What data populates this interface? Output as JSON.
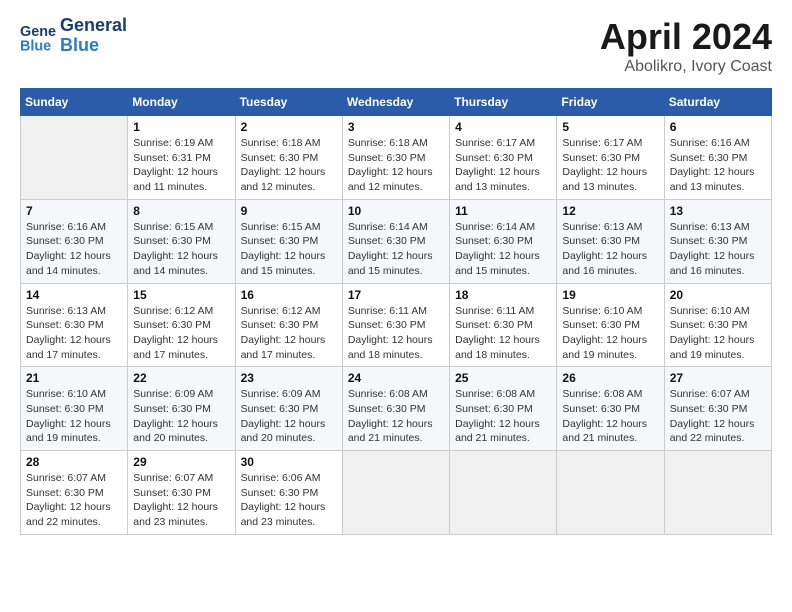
{
  "header": {
    "logo_general": "General",
    "logo_blue": "Blue",
    "month_title": "April 2024",
    "location": "Abolikro, Ivory Coast"
  },
  "weekdays": [
    "Sunday",
    "Monday",
    "Tuesday",
    "Wednesday",
    "Thursday",
    "Friday",
    "Saturday"
  ],
  "weeks": [
    [
      {
        "day": "",
        "sunrise": "",
        "sunset": "",
        "daylight": "",
        "empty": true
      },
      {
        "day": "1",
        "sunrise": "Sunrise: 6:19 AM",
        "sunset": "Sunset: 6:31 PM",
        "daylight": "Daylight: 12 hours and 11 minutes.",
        "empty": false
      },
      {
        "day": "2",
        "sunrise": "Sunrise: 6:18 AM",
        "sunset": "Sunset: 6:30 PM",
        "daylight": "Daylight: 12 hours and 12 minutes.",
        "empty": false
      },
      {
        "day": "3",
        "sunrise": "Sunrise: 6:18 AM",
        "sunset": "Sunset: 6:30 PM",
        "daylight": "Daylight: 12 hours and 12 minutes.",
        "empty": false
      },
      {
        "day": "4",
        "sunrise": "Sunrise: 6:17 AM",
        "sunset": "Sunset: 6:30 PM",
        "daylight": "Daylight: 12 hours and 13 minutes.",
        "empty": false
      },
      {
        "day": "5",
        "sunrise": "Sunrise: 6:17 AM",
        "sunset": "Sunset: 6:30 PM",
        "daylight": "Daylight: 12 hours and 13 minutes.",
        "empty": false
      },
      {
        "day": "6",
        "sunrise": "Sunrise: 6:16 AM",
        "sunset": "Sunset: 6:30 PM",
        "daylight": "Daylight: 12 hours and 13 minutes.",
        "empty": false
      }
    ],
    [
      {
        "day": "7",
        "sunrise": "Sunrise: 6:16 AM",
        "sunset": "Sunset: 6:30 PM",
        "daylight": "Daylight: 12 hours and 14 minutes.",
        "empty": false
      },
      {
        "day": "8",
        "sunrise": "Sunrise: 6:15 AM",
        "sunset": "Sunset: 6:30 PM",
        "daylight": "Daylight: 12 hours and 14 minutes.",
        "empty": false
      },
      {
        "day": "9",
        "sunrise": "Sunrise: 6:15 AM",
        "sunset": "Sunset: 6:30 PM",
        "daylight": "Daylight: 12 hours and 15 minutes.",
        "empty": false
      },
      {
        "day": "10",
        "sunrise": "Sunrise: 6:14 AM",
        "sunset": "Sunset: 6:30 PM",
        "daylight": "Daylight: 12 hours and 15 minutes.",
        "empty": false
      },
      {
        "day": "11",
        "sunrise": "Sunrise: 6:14 AM",
        "sunset": "Sunset: 6:30 PM",
        "daylight": "Daylight: 12 hours and 15 minutes.",
        "empty": false
      },
      {
        "day": "12",
        "sunrise": "Sunrise: 6:13 AM",
        "sunset": "Sunset: 6:30 PM",
        "daylight": "Daylight: 12 hours and 16 minutes.",
        "empty": false
      },
      {
        "day": "13",
        "sunrise": "Sunrise: 6:13 AM",
        "sunset": "Sunset: 6:30 PM",
        "daylight": "Daylight: 12 hours and 16 minutes.",
        "empty": false
      }
    ],
    [
      {
        "day": "14",
        "sunrise": "Sunrise: 6:13 AM",
        "sunset": "Sunset: 6:30 PM",
        "daylight": "Daylight: 12 hours and 17 minutes.",
        "empty": false
      },
      {
        "day": "15",
        "sunrise": "Sunrise: 6:12 AM",
        "sunset": "Sunset: 6:30 PM",
        "daylight": "Daylight: 12 hours and 17 minutes.",
        "empty": false
      },
      {
        "day": "16",
        "sunrise": "Sunrise: 6:12 AM",
        "sunset": "Sunset: 6:30 PM",
        "daylight": "Daylight: 12 hours and 17 minutes.",
        "empty": false
      },
      {
        "day": "17",
        "sunrise": "Sunrise: 6:11 AM",
        "sunset": "Sunset: 6:30 PM",
        "daylight": "Daylight: 12 hours and 18 minutes.",
        "empty": false
      },
      {
        "day": "18",
        "sunrise": "Sunrise: 6:11 AM",
        "sunset": "Sunset: 6:30 PM",
        "daylight": "Daylight: 12 hours and 18 minutes.",
        "empty": false
      },
      {
        "day": "19",
        "sunrise": "Sunrise: 6:10 AM",
        "sunset": "Sunset: 6:30 PM",
        "daylight": "Daylight: 12 hours and 19 minutes.",
        "empty": false
      },
      {
        "day": "20",
        "sunrise": "Sunrise: 6:10 AM",
        "sunset": "Sunset: 6:30 PM",
        "daylight": "Daylight: 12 hours and 19 minutes.",
        "empty": false
      }
    ],
    [
      {
        "day": "21",
        "sunrise": "Sunrise: 6:10 AM",
        "sunset": "Sunset: 6:30 PM",
        "daylight": "Daylight: 12 hours and 19 minutes.",
        "empty": false
      },
      {
        "day": "22",
        "sunrise": "Sunrise: 6:09 AM",
        "sunset": "Sunset: 6:30 PM",
        "daylight": "Daylight: 12 hours and 20 minutes.",
        "empty": false
      },
      {
        "day": "23",
        "sunrise": "Sunrise: 6:09 AM",
        "sunset": "Sunset: 6:30 PM",
        "daylight": "Daylight: 12 hours and 20 minutes.",
        "empty": false
      },
      {
        "day": "24",
        "sunrise": "Sunrise: 6:08 AM",
        "sunset": "Sunset: 6:30 PM",
        "daylight": "Daylight: 12 hours and 21 minutes.",
        "empty": false
      },
      {
        "day": "25",
        "sunrise": "Sunrise: 6:08 AM",
        "sunset": "Sunset: 6:30 PM",
        "daylight": "Daylight: 12 hours and 21 minutes.",
        "empty": false
      },
      {
        "day": "26",
        "sunrise": "Sunrise: 6:08 AM",
        "sunset": "Sunset: 6:30 PM",
        "daylight": "Daylight: 12 hours and 21 minutes.",
        "empty": false
      },
      {
        "day": "27",
        "sunrise": "Sunrise: 6:07 AM",
        "sunset": "Sunset: 6:30 PM",
        "daylight": "Daylight: 12 hours and 22 minutes.",
        "empty": false
      }
    ],
    [
      {
        "day": "28",
        "sunrise": "Sunrise: 6:07 AM",
        "sunset": "Sunset: 6:30 PM",
        "daylight": "Daylight: 12 hours and 22 minutes.",
        "empty": false
      },
      {
        "day": "29",
        "sunrise": "Sunrise: 6:07 AM",
        "sunset": "Sunset: 6:30 PM",
        "daylight": "Daylight: 12 hours and 23 minutes.",
        "empty": false
      },
      {
        "day": "30",
        "sunrise": "Sunrise: 6:06 AM",
        "sunset": "Sunset: 6:30 PM",
        "daylight": "Daylight: 12 hours and 23 minutes.",
        "empty": false
      },
      {
        "day": "",
        "sunrise": "",
        "sunset": "",
        "daylight": "",
        "empty": true
      },
      {
        "day": "",
        "sunrise": "",
        "sunset": "",
        "daylight": "",
        "empty": true
      },
      {
        "day": "",
        "sunrise": "",
        "sunset": "",
        "daylight": "",
        "empty": true
      },
      {
        "day": "",
        "sunrise": "",
        "sunset": "",
        "daylight": "",
        "empty": true
      }
    ]
  ]
}
